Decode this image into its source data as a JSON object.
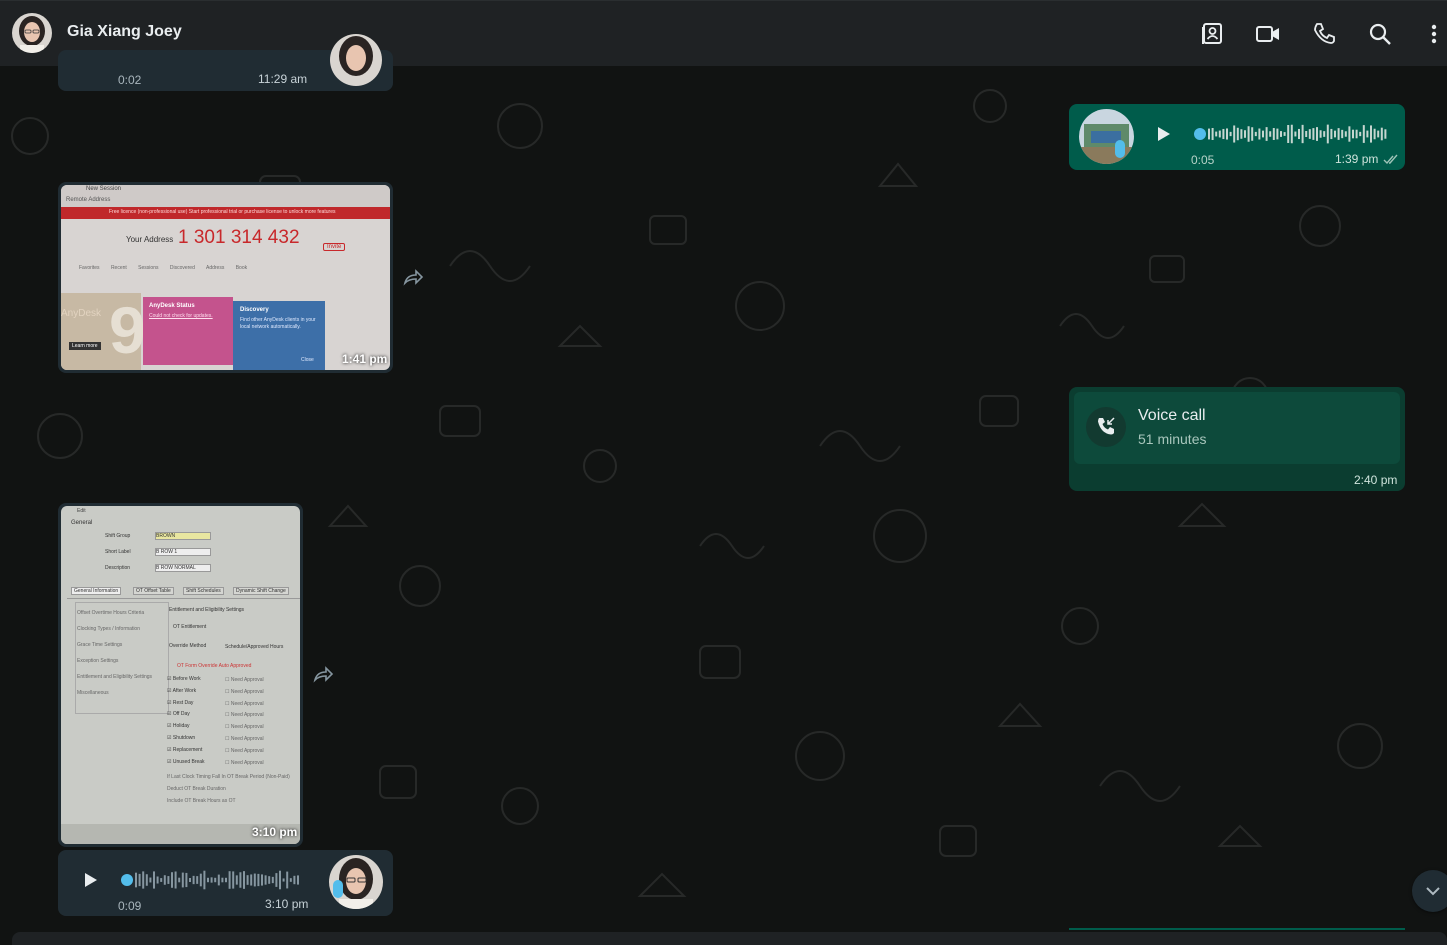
{
  "header": {
    "contact_name": "Gia Xiang Joey",
    "icons": [
      "contact-card-icon",
      "video-call-icon",
      "phone-icon",
      "search-icon",
      "menu-dots-icon"
    ]
  },
  "messages": {
    "voice_top_in": {
      "duration": "0:02",
      "time": "11:29 am"
    },
    "voice_out_1": {
      "duration": "0:05",
      "time": "1:39 pm",
      "status": "read-ticks"
    },
    "image_anydesk": {
      "time": "1:41 pm",
      "window_tab": "New Session",
      "window_hint": "Remote Address",
      "banner": "Free licence (non-professional use) Start professional trial or purchase license to unlock more features",
      "address_label": "Your Address",
      "address_value": "1 301 314 432",
      "invite_label": "Invite",
      "tabs": [
        "Favorites",
        "Recent Sessions",
        "Discovered",
        "Address Book"
      ],
      "logo_text": "AnyDesk",
      "learn_more": "Learn more",
      "status_card_title": "AnyDesk Status",
      "status_card_text": "Could not check for updates.",
      "discovery_title": "Discovery",
      "discovery_text": "Find other AnyDesk clients in your local network automatically.",
      "close_label": "Close"
    },
    "voice_call_out": {
      "title": "Voice call",
      "subtitle": "51 minutes",
      "time": "2:40 pm"
    },
    "image_shift": {
      "time": "3:10 pm",
      "edit_label": "Edit",
      "general_label": "General",
      "fields": [
        {
          "label": "Shift Group",
          "value": "BROWN"
        },
        {
          "label": "Short Label",
          "value": "B ROW 1"
        },
        {
          "label": "Description",
          "value": "B ROW NORMAL"
        }
      ],
      "tabs": [
        "General Information",
        "OT Offset Table",
        "Shift Schedules",
        "Dynamic Shift Change"
      ],
      "left_menu": [
        "Offset Overtime Hours Criteria",
        "Clocking Types / Information",
        "Grace Time Settings",
        "Exception Settings",
        "Entitlement and Eligibility Settings",
        "Miscellaneous"
      ],
      "section_title": "Entitlement and Eligibility Settings",
      "ot_entitlement": "OT Entitlement",
      "override_method": "Override Method",
      "schedule_hours": "Schedule/Approved Hours",
      "auto_approved": "OT Form Override Auto Approved",
      "rows": [
        "Before Work",
        "After Work",
        "Rest Day",
        "Off Day",
        "Holiday",
        "Shutdown",
        "Replacement",
        "Unused Break"
      ],
      "need_approval": "Need Approval",
      "footer_lines": [
        "If Last Clock Timing Fall In OT Break Period (Non-Paid)",
        "Deduct OT Break Duration",
        "Include OT Break Hours as OT"
      ]
    },
    "voice_bottom_in": {
      "duration": "0:09",
      "time": "3:10 pm"
    }
  },
  "colors": {
    "background": "#111312",
    "header": "#1f2224",
    "incoming": "#202c33",
    "outgoing": "#005c4b",
    "accent_dot": "#53bdeb"
  }
}
